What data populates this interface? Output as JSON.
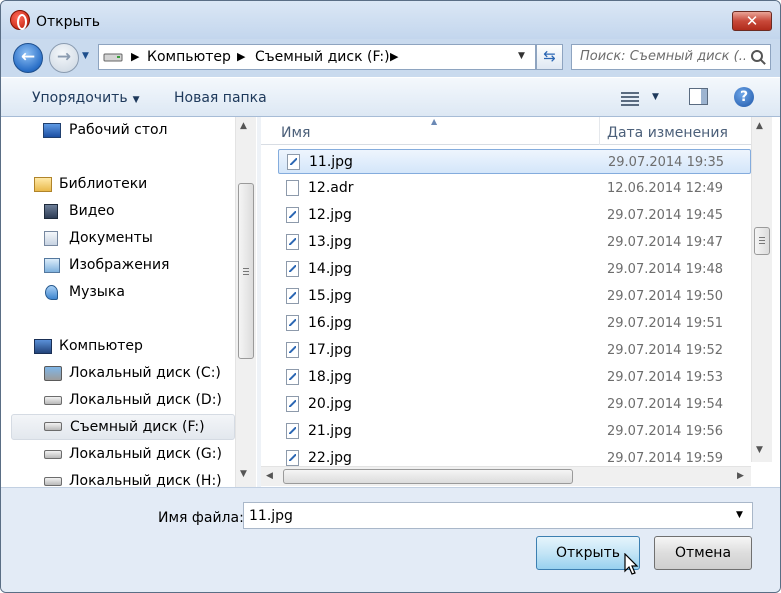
{
  "window": {
    "title": "Открыть",
    "close_label": "✕"
  },
  "nav": {
    "back_glyph": "←",
    "forward_glyph": "→",
    "history_glyph": "▼",
    "address": {
      "parts": [
        "Компьютер",
        "Съемный диск (F:)"
      ],
      "separator_glyph": "▶",
      "dropdown_glyph": "▼"
    },
    "refresh_glyph": "⇆",
    "search_placeholder": "Поиск: Съемный диск (..."
  },
  "toolbar": {
    "organize_label": "Упорядочить",
    "organize_caret": "▼",
    "new_folder_label": "Новая папка",
    "view_caret": "▼",
    "help_glyph": "?"
  },
  "sidebar": {
    "items": [
      {
        "label": "Рабочий стол",
        "icon": "desktop-icon"
      },
      {
        "label": "Библиотеки",
        "icon": "libraries-icon"
      },
      {
        "label": "Видео",
        "icon": "video-icon"
      },
      {
        "label": "Документы",
        "icon": "documents-icon"
      },
      {
        "label": "Изображения",
        "icon": "images-icon"
      },
      {
        "label": "Музыка",
        "icon": "music-icon"
      },
      {
        "label": "Компьютер",
        "icon": "computer-icon"
      },
      {
        "label": "Локальный диск (C:)",
        "icon": "system-drive-icon"
      },
      {
        "label": "Локальный диск (D:)",
        "icon": "drive-icon"
      },
      {
        "label": "Съемный диск (F:)",
        "icon": "removable-drive-icon",
        "selected": true
      },
      {
        "label": "Локальный диск (G:)",
        "icon": "drive-icon"
      },
      {
        "label": "Локальный диск (H:)",
        "icon": "drive-icon"
      }
    ],
    "scroll_up_glyph": "▲",
    "scroll_down_glyph": "▼"
  },
  "files": {
    "columns": {
      "name": "Имя",
      "date": "Дата изменения"
    },
    "sort_glyph": "▲",
    "rows": [
      {
        "name": "11.jpg",
        "date": "29.07.2014 19:35",
        "type": "image",
        "selected": true
      },
      {
        "name": "12.adr",
        "date": "12.06.2014 12:49",
        "type": "file"
      },
      {
        "name": "12.jpg",
        "date": "29.07.2014 19:45",
        "type": "image"
      },
      {
        "name": "13.jpg",
        "date": "29.07.2014 19:47",
        "type": "image"
      },
      {
        "name": "14.jpg",
        "date": "29.07.2014 19:48",
        "type": "image"
      },
      {
        "name": "15.jpg",
        "date": "29.07.2014 19:50",
        "type": "image"
      },
      {
        "name": "16.jpg",
        "date": "29.07.2014 19:51",
        "type": "image"
      },
      {
        "name": "17.jpg",
        "date": "29.07.2014 19:52",
        "type": "image"
      },
      {
        "name": "18.jpg",
        "date": "29.07.2014 19:53",
        "type": "image"
      },
      {
        "name": "20.jpg",
        "date": "29.07.2014 19:54",
        "type": "image"
      },
      {
        "name": "21.jpg",
        "date": "29.07.2014 19:56",
        "type": "image"
      },
      {
        "name": "22.jpg",
        "date": "29.07.2014 19:59",
        "type": "image"
      }
    ],
    "hscroll_left_glyph": "◀",
    "hscroll_right_glyph": "▶"
  },
  "footer": {
    "filename_label": "Имя файла:",
    "filename_value": "11.jpg",
    "filename_dropdown_glyph": "▼",
    "open_label": "Открыть",
    "cancel_label": "Отмена"
  }
}
